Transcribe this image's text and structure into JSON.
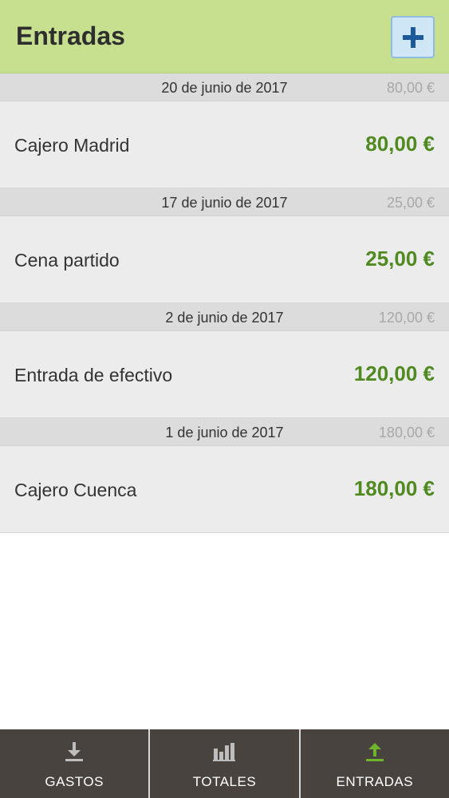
{
  "header": {
    "title": "Entradas",
    "add_icon": "plus-icon"
  },
  "colors": {
    "header_bg": "#c6e08f",
    "amount": "#4e8a1f",
    "tabbar_bg": "#49433f",
    "active_tab_icon": "#6fb52c"
  },
  "groups": [
    {
      "date": "20 de junio de 2017",
      "total": "80,00 €",
      "item": {
        "label": "Cajero Madrid",
        "amount": "80,00 €"
      }
    },
    {
      "date": "17 de junio de 2017",
      "total": "25,00 €",
      "item": {
        "label": "Cena partido",
        "amount": "25,00 €"
      }
    },
    {
      "date": "2 de junio de 2017",
      "total": "120,00 €",
      "item": {
        "label": "Entrada de efectivo",
        "amount": "120,00 €"
      }
    },
    {
      "date": "1 de junio de 2017",
      "total": "180,00 €",
      "item": {
        "label": "Cajero Cuenca",
        "amount": "180,00 €"
      }
    }
  ],
  "tabbar": {
    "tabs": [
      {
        "label": "GASTOS",
        "icon": "download-icon",
        "active": false
      },
      {
        "label": "TOTALES",
        "icon": "bar-chart-icon",
        "active": false
      },
      {
        "label": "ENTRADAS",
        "icon": "upload-icon",
        "active": true
      }
    ]
  }
}
